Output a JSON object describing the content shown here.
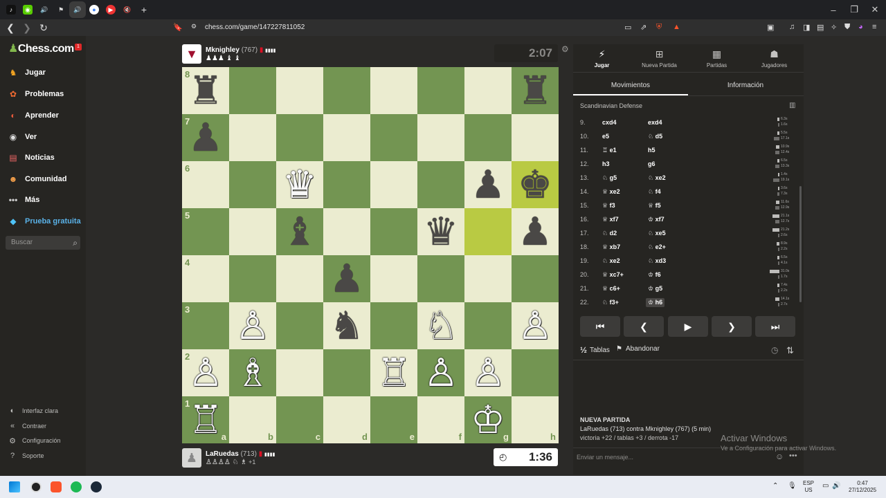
{
  "browser": {
    "url": "chess.com/game/147227811052",
    "tabs": [
      "tiktok",
      "duolingo",
      "sound",
      "teams",
      "sound-active",
      "chrome",
      "youtube",
      "muted"
    ],
    "new_tab": "+"
  },
  "sidebar": {
    "logo": "Chess.com",
    "logo_badge": "1",
    "items": [
      {
        "label": "Jugar",
        "icon": "play-icon"
      },
      {
        "label": "Problemas",
        "icon": "puzzle-icon"
      },
      {
        "label": "Aprender",
        "icon": "learn-icon"
      },
      {
        "label": "Ver",
        "icon": "watch-icon"
      },
      {
        "label": "Noticias",
        "icon": "news-icon"
      },
      {
        "label": "Comunidad",
        "icon": "community-icon"
      },
      {
        "label": "Más",
        "icon": "more-icon"
      },
      {
        "label": "Prueba gratuita",
        "icon": "diamond-icon"
      }
    ],
    "search_placeholder": "Buscar",
    "bottom": [
      {
        "label": "Interfaz clara",
        "icon": "theme-icon"
      },
      {
        "label": "Contraer",
        "icon": "collapse-icon"
      },
      {
        "label": "Configuración",
        "icon": "gear-icon"
      },
      {
        "label": "Soporte",
        "icon": "help-icon"
      }
    ]
  },
  "top_player": {
    "name": "Mknighley",
    "rating": "(767)",
    "clock": "2:07",
    "captured": "♟♟♟ ♝ ♝"
  },
  "bottom_player": {
    "name": "LaRuedas",
    "rating": "(713)",
    "clock": "1:36",
    "captured": "♙♙♙♙ ♘ ♗",
    "extra": "+1"
  },
  "board": {
    "files": [
      "a",
      "b",
      "c",
      "d",
      "e",
      "f",
      "g",
      "h"
    ],
    "ranks": [
      "8",
      "7",
      "6",
      "5",
      "4",
      "3",
      "2",
      "1"
    ],
    "highlights": [
      "h6",
      "g5"
    ],
    "pieces": [
      {
        "sq": "a8",
        "p": "♜",
        "c": "b"
      },
      {
        "sq": "h8",
        "p": "♜",
        "c": "b"
      },
      {
        "sq": "a7",
        "p": "♟",
        "c": "b"
      },
      {
        "sq": "c6",
        "p": "♛",
        "c": "w"
      },
      {
        "sq": "g6",
        "p": "♟",
        "c": "b"
      },
      {
        "sq": "h6",
        "p": "♚",
        "c": "b"
      },
      {
        "sq": "c5",
        "p": "♝",
        "c": "b"
      },
      {
        "sq": "f5",
        "p": "♛",
        "c": "b"
      },
      {
        "sq": "h5",
        "p": "♟",
        "c": "b"
      },
      {
        "sq": "d4",
        "p": "♟",
        "c": "b"
      },
      {
        "sq": "b3",
        "p": "♙",
        "c": "w"
      },
      {
        "sq": "d3",
        "p": "♞",
        "c": "b"
      },
      {
        "sq": "f3",
        "p": "♘",
        "c": "w"
      },
      {
        "sq": "h3",
        "p": "♙",
        "c": "w"
      },
      {
        "sq": "a2",
        "p": "♙",
        "c": "w"
      },
      {
        "sq": "b2",
        "p": "♗",
        "c": "w"
      },
      {
        "sq": "e2",
        "p": "♖",
        "c": "w"
      },
      {
        "sq": "f2",
        "p": "♙",
        "c": "w"
      },
      {
        "sq": "g2",
        "p": "♙",
        "c": "w"
      },
      {
        "sq": "a1",
        "p": "♖",
        "c": "w"
      },
      {
        "sq": "g1",
        "p": "♔",
        "c": "w"
      }
    ]
  },
  "panel": {
    "tabs": [
      {
        "label": "Jugar",
        "icon": "lightning-icon"
      },
      {
        "label": "Nueva Partida",
        "icon": "plus-icon"
      },
      {
        "label": "Partidas",
        "icon": "board-icon"
      },
      {
        "label": "Jugadores",
        "icon": "players-icon"
      }
    ],
    "subtabs": [
      "Movimientos",
      "Información"
    ],
    "opening": "Scandinavian Defense",
    "moves": [
      {
        "n": "9.",
        "w": "cxd4",
        "b": "exd4",
        "wt": "6.3s",
        "bt": "1.6s",
        "wf": 0.2,
        "bf": 0.05
      },
      {
        "n": "10.",
        "w": "e5",
        "b": "♘ d5",
        "wt": "5.5s",
        "bt": "17.1s",
        "wf": 0.18,
        "bf": 0.55
      },
      {
        "n": "11.",
        "w": "♖ e1",
        "b": "h5",
        "wt": "10.9s",
        "bt": "12.4s",
        "wf": 0.35,
        "bf": 0.4
      },
      {
        "n": "12.",
        "w": "h3",
        "b": "g6",
        "wt": "6.5s",
        "bt": "13.3s",
        "wf": 0.21,
        "bf": 0.43
      },
      {
        "n": "13.",
        "w": "♘ g5",
        "b": "♘ xe2",
        "wt": "1.4s",
        "bt": "19.1s",
        "wf": 0.05,
        "bf": 0.62
      },
      {
        "n": "14.",
        "w": "♕ xe2",
        "b": "♘ f4",
        "wt": "3.6s",
        "bt": "7.3s",
        "wf": 0.12,
        "bf": 0.24
      },
      {
        "n": "15.",
        "w": "♕ f3",
        "b": "♕ f5",
        "wt": "11.6s",
        "bt": "12.9s",
        "wf": 0.37,
        "bf": 0.42
      },
      {
        "n": "16.",
        "w": "♕ xf7",
        "b": "♔ xf7",
        "wt": "21.1s",
        "bt": "12.7s",
        "wf": 0.68,
        "bf": 0.41
      },
      {
        "n": "17.",
        "w": "♘ d2",
        "b": "♘ xe5",
        "wt": "21.2s",
        "bt": "2.6s",
        "wf": 0.68,
        "bf": 0.08
      },
      {
        "n": "18.",
        "w": "♕ xb7",
        "b": "♘ e2+",
        "wt": "8.9s",
        "bt": "2.2s",
        "wf": 0.29,
        "bf": 0.07
      },
      {
        "n": "19.",
        "w": "♘ xe2",
        "b": "♘ xd3",
        "wt": "6.5s",
        "bt": "4.1s",
        "wf": 0.21,
        "bf": 0.13
      },
      {
        "n": "20.",
        "w": "♕ xc7+",
        "b": "♔ f6",
        "wt": "31.0s",
        "bt": "1.7s",
        "wf": 1.0,
        "bf": 0.05
      },
      {
        "n": "21.",
        "w": "♕ c6+",
        "b": "♔ g5",
        "wt": "7.4s",
        "bt": "2.2s",
        "wf": 0.24,
        "bf": 0.07
      },
      {
        "n": "22.",
        "w": "♘ f3+",
        "b": "♔ h6",
        "wt": "14.1s",
        "bt": "2.7s",
        "wf": 0.45,
        "bf": 0.09
      }
    ],
    "controls": [
      "⏮",
      "❮",
      "▶",
      "❯",
      "⏭"
    ],
    "draw_label": "Tablas",
    "draw_icon": "½",
    "resign_label": "Abandonar",
    "new_game_title": "NUEVA PARTIDA",
    "new_game_line": "LaRuedas (713) contra Mknighley (767) (5 min)",
    "new_game_stats": "victoria +22 / tablas +3 / derrota -17",
    "chat_placeholder": "Enviar un mensaje..."
  },
  "watermark": {
    "title": "Activar Windows",
    "subtitle": "Ve a Configuración para activar Windows."
  },
  "taskbar": {
    "lang": "ESP",
    "region": "US",
    "time": "0:47",
    "date": "27/12/2025"
  }
}
